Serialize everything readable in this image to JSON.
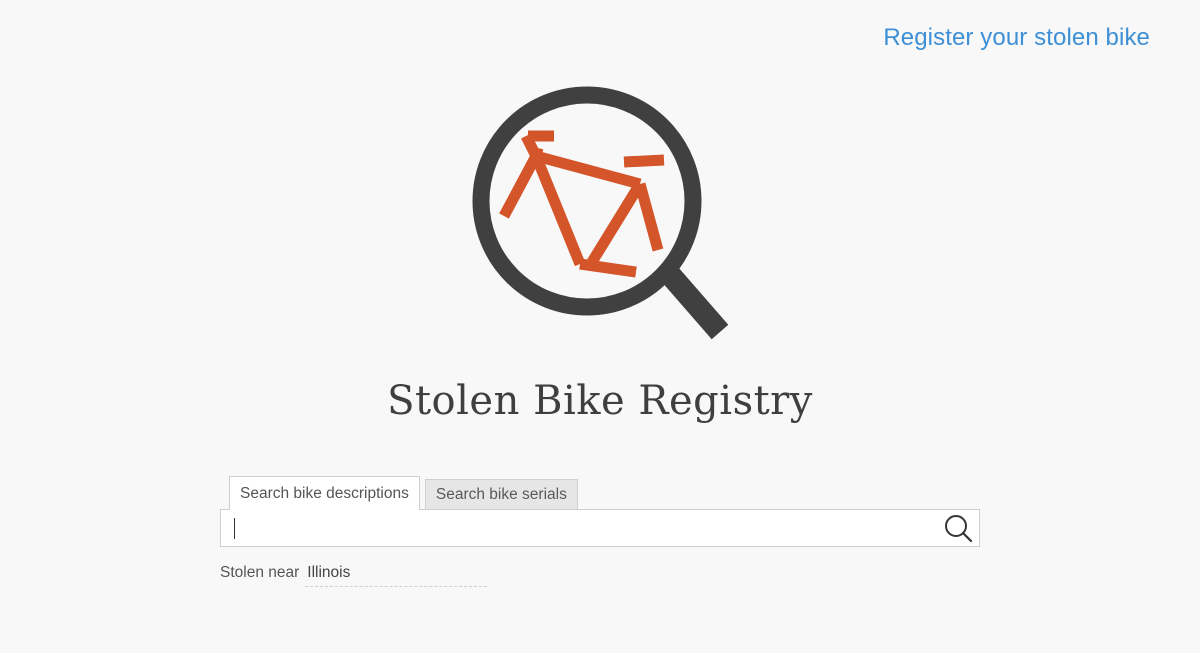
{
  "header": {
    "register_link": "Register your stolen bike"
  },
  "logo": {
    "name": "magnifier-bike-logo",
    "colors": {
      "ring": "#404040",
      "bike": "#d4552a"
    }
  },
  "main": {
    "title": "Stolen Bike Registry",
    "tabs": [
      {
        "label": "Search bike descriptions",
        "active": true
      },
      {
        "label": "Search bike serials",
        "active": false
      }
    ],
    "search": {
      "value": "",
      "placeholder": "",
      "button_icon": "search-icon"
    },
    "location": {
      "label": "Stolen near",
      "value": "Illinois"
    }
  },
  "colors": {
    "background": "#f8f8f8",
    "link": "#3d8fd6",
    "title": "#3f3f3f"
  }
}
